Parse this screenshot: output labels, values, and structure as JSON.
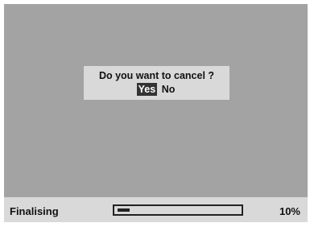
{
  "colors": {
    "screen_background": "#a3a3a3",
    "panel_background": "#d9d9d9",
    "selected_option_background": "#333333",
    "selected_option_text": "#ffffff",
    "text": "#111111"
  },
  "dialog": {
    "question": "Do you want to cancel ?",
    "options": [
      {
        "label": "Yes",
        "selected": true
      },
      {
        "label": "No",
        "selected": false
      }
    ]
  },
  "status": {
    "label": "Finalising",
    "progress_percent": 10,
    "progress_text": "10%"
  }
}
